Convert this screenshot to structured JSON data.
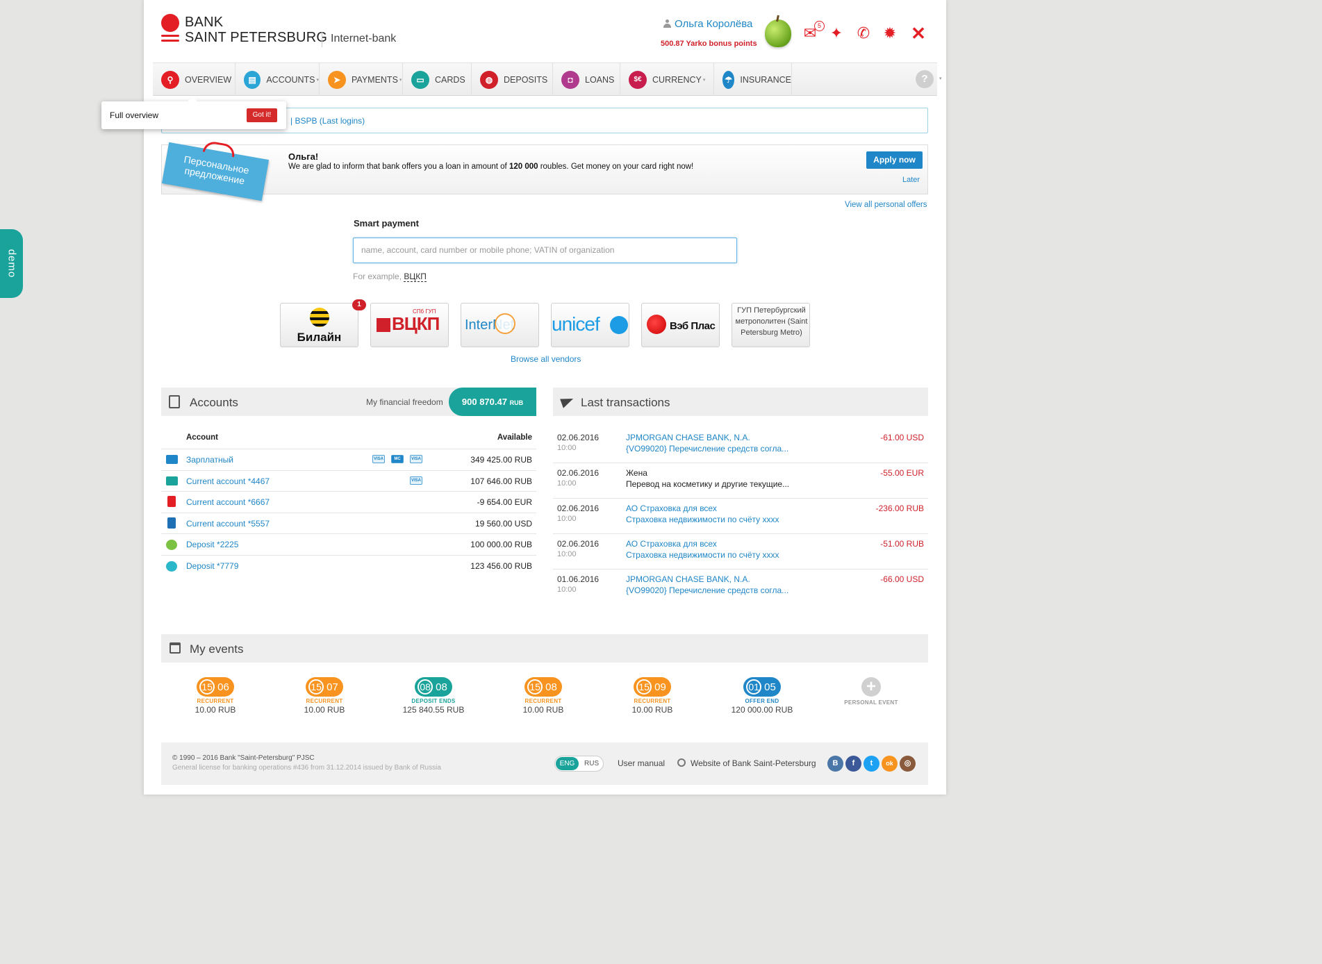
{
  "demo_tab": "demo",
  "header": {
    "brand_line1": "BANK",
    "brand_line2": "SAINT PETERSBURG",
    "product": "Internet-bank",
    "user_name": "Ольга Королёва",
    "bonus": "500.87 Yarko bonus points",
    "mail_count": "5",
    "brand_color": "#e31e24"
  },
  "nav": {
    "items": [
      {
        "label": "OVERVIEW",
        "icon": "search-icon",
        "color": "#e31e24"
      },
      {
        "label": "ACCOUNTS",
        "icon": "clipboard-icon",
        "color": "#2ba4d6"
      },
      {
        "label": "PAYMENTS",
        "icon": "paper-plane-icon",
        "color": "#f7931e"
      },
      {
        "label": "CARDS",
        "icon": "card-icon",
        "color": "#1aa39b"
      },
      {
        "label": "DEPOSITS",
        "icon": "piggy-bank-icon",
        "color": "#d0212a"
      },
      {
        "label": "LOANS",
        "icon": "bag-icon",
        "color": "#b03a8e"
      },
      {
        "label": "CURRENCY",
        "icon": "currency-icon",
        "color": "#c81e4e"
      },
      {
        "label": "INSURANCE",
        "icon": "umbrella-icon",
        "color": "#1f86c7"
      }
    ],
    "help": "?"
  },
  "tooltip": {
    "text": "Full overview",
    "button": "Got it!"
  },
  "last_logins": "| BSPB (Last logins)",
  "offer": {
    "ribbon": "Персональное предложение",
    "heading": "Ольга!",
    "text_before": "We are glad to inform that bank offers you a loan in amount of ",
    "amount": "120 000",
    "text_after": " roubles. Get money on your card right now!",
    "apply": "Apply now",
    "later": "Later",
    "view_all": "View all personal offers"
  },
  "smart_payment": {
    "label": "Smart payment",
    "placeholder": "name, account, card number or mobile phone; VATIN of organization",
    "example_prefix": "For example, ",
    "example_value": "ВЦКП"
  },
  "vendors": {
    "items": [
      "Билайн",
      "ВЦКП",
      "InterNet",
      "unicef",
      "Вэб Плас",
      "ГУП Петербургский метрополитен (Saint Petersburg Metro)"
    ],
    "beeline_badge": "1",
    "vckp_sub": "СПб ГУП",
    "browse": "Browse all vendors"
  },
  "accounts": {
    "title": "Accounts",
    "freedom_label": "My financial freedom",
    "freedom_value": "900 870.47",
    "freedom_currency": "RUB",
    "col_account": "Account",
    "col_available": "Available",
    "rows": [
      {
        "name": "Зарплатный",
        "amount": "349 425.00 RUB",
        "cards": [
          "VISA",
          "MC",
          "VISA"
        ],
        "color": "#1f86c7"
      },
      {
        "name": "Current account *4467",
        "amount": "107 646.00 RUB",
        "cards": [
          "VISA"
        ],
        "color": "#1aa39b"
      },
      {
        "name": "Current account *6667",
        "amount": "-9 654.00 EUR",
        "cards": [],
        "color": "#e31e24"
      },
      {
        "name": "Current account *5557",
        "amount": "19 560.00 USD",
        "cards": [],
        "color": "#1f6fb4"
      },
      {
        "name": "Deposit *2225",
        "amount": "100 000.00 RUB",
        "cards": [],
        "color": "#7cc242"
      },
      {
        "name": "Deposit *7779",
        "amount": "123 456.00 RUB",
        "cards": [],
        "color": "#2ab7c9"
      }
    ]
  },
  "transactions": {
    "title": "Last transactions",
    "rows": [
      {
        "date": "02.06.2016",
        "time": "10:00",
        "payee": "JPMORGAN CHASE BANK, N.A.",
        "desc": "{VO99020} Перечисление средств согла...",
        "amount": "-61.00 USD",
        "link": true
      },
      {
        "date": "02.06.2016",
        "time": "10:00",
        "payee": "Жена",
        "desc": "Перевод на косметику и другие текущие...",
        "amount": "-55.00 EUR",
        "link": false
      },
      {
        "date": "02.06.2016",
        "time": "10:00",
        "payee": "АО Страховка для всех",
        "desc": "Страховка недвижимости по счёту xxxx",
        "amount": "-236.00 RUB",
        "link": true
      },
      {
        "date": "02.06.2016",
        "time": "10:00",
        "payee": "АО Страховка для всех",
        "desc": "Страховка недвижимости по счёту xxxx",
        "amount": "-51.00 RUB",
        "link": true
      },
      {
        "date": "01.06.2016",
        "time": "10:00",
        "payee": "JPMORGAN CHASE BANK, N.A.",
        "desc": "{VO99020} Перечисление средств согла...",
        "amount": "-66.00 USD",
        "link": true
      }
    ]
  },
  "events": {
    "title": "My events",
    "items": [
      {
        "day": "15",
        "month": "06",
        "label": "RECURRENT",
        "amount": "10.00 RUB",
        "color": "#f7931e"
      },
      {
        "day": "15",
        "month": "07",
        "label": "RECURRENT",
        "amount": "10.00 RUB",
        "color": "#f7931e"
      },
      {
        "day": "08",
        "month": "08",
        "label": "DEPOSIT ENDS",
        "amount": "125 840.55 RUB",
        "color": "#1aa39b"
      },
      {
        "day": "15",
        "month": "08",
        "label": "RECURRENT",
        "amount": "10.00 RUB",
        "color": "#f7931e"
      },
      {
        "day": "15",
        "month": "09",
        "label": "RECURRENT",
        "amount": "10.00 RUB",
        "color": "#f7931e"
      },
      {
        "day": "01",
        "month": "05",
        "label": "OFFER END",
        "amount": "120 000.00 RUB",
        "color": "#1f86c7"
      }
    ],
    "personal_label": "PERSONAL EVENT"
  },
  "footer": {
    "copyright": "© 1990 – 2016 Bank \"Saint-Petersburg\" PJSC",
    "license": "General license for banking operations #436 from 31.12.2014 issued by Bank of Russia",
    "lang_active": "ENG",
    "lang_other": "RUS",
    "manual": "User manual",
    "website": "Website of Bank Saint-Petersburg",
    "social": [
      {
        "icon": "vk-icon",
        "glyph": "В",
        "color": "#4a76a8"
      },
      {
        "icon": "facebook-icon",
        "glyph": "f",
        "color": "#3b5998"
      },
      {
        "icon": "twitter-icon",
        "glyph": "t",
        "color": "#1da1f2"
      },
      {
        "icon": "odnoklassniki-icon",
        "glyph": "ok",
        "color": "#f7931e"
      },
      {
        "icon": "instagram-icon",
        "glyph": "◎",
        "color": "#8a5a3c"
      }
    ]
  }
}
